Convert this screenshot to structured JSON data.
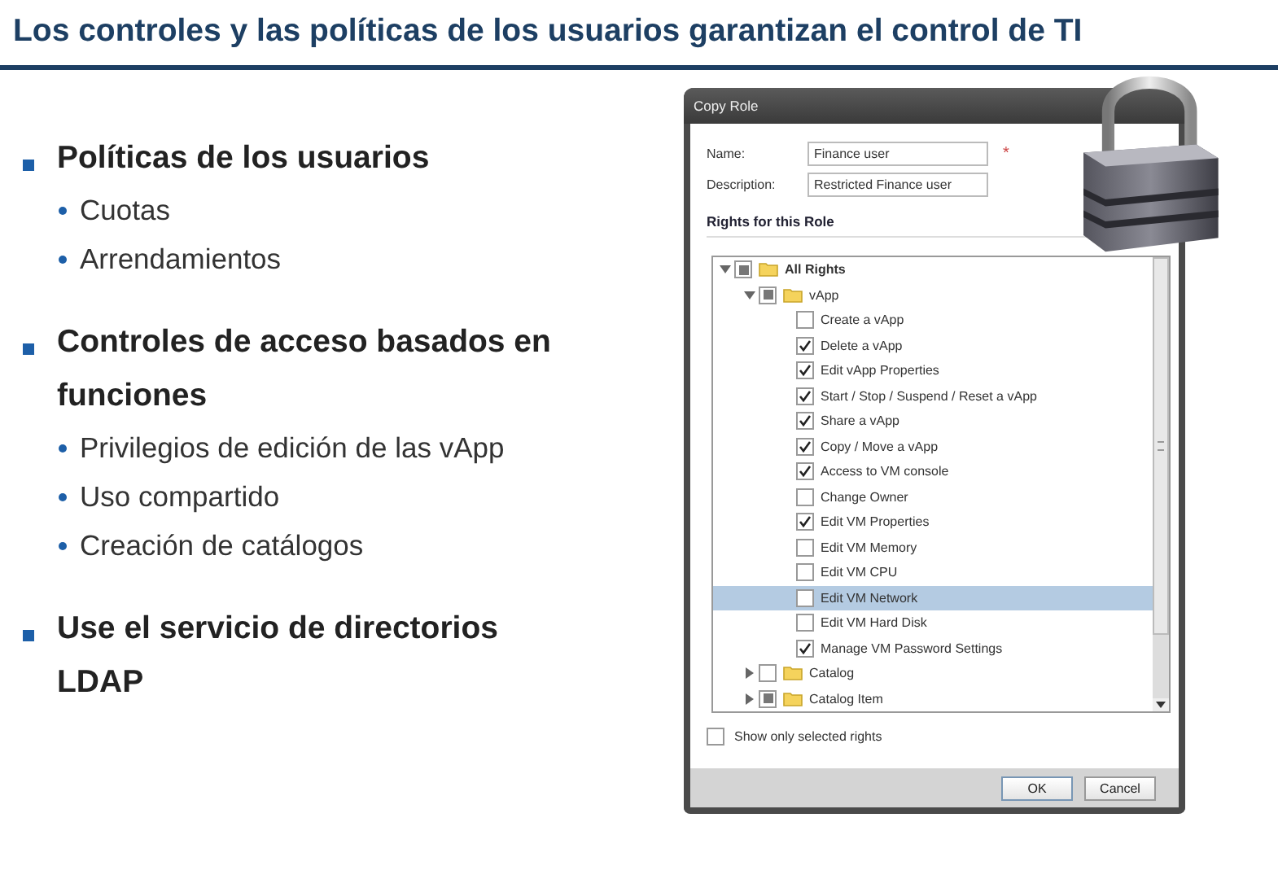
{
  "title": "Los controles y las políticas de los usuarios garantizan el control de TI",
  "bullets": [
    {
      "text": "Políticas de los usuarios",
      "sub": [
        "Cuotas",
        "Arrendamientos"
      ]
    },
    {
      "text": "Controles de acceso basados en funciones",
      "sub": [
        "Privilegios de edición de las vApp",
        "Uso compartido",
        "Creación de catálogos"
      ]
    },
    {
      "text": "Use el servicio de directorios LDAP"
    }
  ],
  "dialog": {
    "title": "Copy Role",
    "fields": [
      {
        "label": "Name:",
        "value": "Finance user",
        "required_mark": "*"
      },
      {
        "label": "Description:",
        "value": "Restricted Finance user"
      }
    ],
    "section_title": "Rights for this Role",
    "tree": [
      {
        "label": "All Rights",
        "expanded": true,
        "partial": true,
        "selected": false,
        "children": [
          {
            "label": "vApp",
            "expanded": true,
            "partial": true,
            "selected": false,
            "children": [
              {
                "label": "Create a vApp",
                "checked": false,
                "selected": false
              },
              {
                "label": "Delete a vApp",
                "checked": true,
                "selected": false
              },
              {
                "label": "Edit vApp Properties",
                "checked": true,
                "selected": false
              },
              {
                "label": "Start / Stop / Suspend / Reset a vApp",
                "checked": true,
                "selected": false
              },
              {
                "label": "Share a vApp",
                "checked": true,
                "selected": false
              },
              {
                "label": "Copy / Move a vApp",
                "checked": true,
                "selected": false
              },
              {
                "label": "Access to VM console",
                "checked": true,
                "selected": false
              },
              {
                "label": "Change Owner",
                "checked": false,
                "selected": false
              },
              {
                "label": "Edit VM Properties",
                "checked": true,
                "selected": false
              },
              {
                "label": "Edit VM Memory",
                "checked": false,
                "selected": false
              },
              {
                "label": "Edit VM CPU",
                "checked": false,
                "selected": false
              },
              {
                "label": "Edit VM Network",
                "checked": false,
                "selected": true
              },
              {
                "label": "Edit VM Hard Disk",
                "checked": false,
                "selected": false
              },
              {
                "label": "Manage VM Password Settings",
                "checked": true,
                "selected": false
              }
            ]
          },
          {
            "label": "Catalog",
            "expanded": false,
            "checked": false,
            "partial": false,
            "selected": false
          },
          {
            "label": "Catalog Item",
            "expanded": false,
            "partial": true,
            "selected": false
          }
        ]
      }
    ],
    "show_only": {
      "label": "Show only selected rights",
      "checked": false
    },
    "buttons": [
      {
        "label": "OK",
        "primary": true
      },
      {
        "label": "Cancel",
        "primary": false
      }
    ]
  }
}
